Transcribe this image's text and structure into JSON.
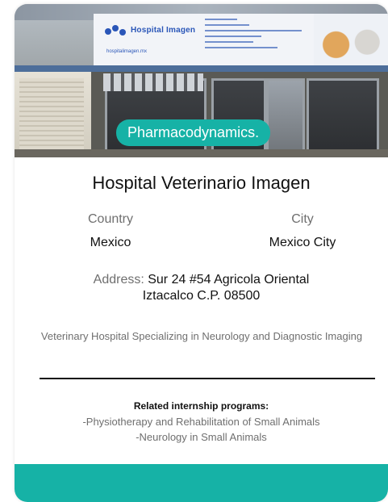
{
  "card": {
    "category_tag": "Pharmacodynamics.",
    "title": "Hospital Veterinario Imagen",
    "country_label": "Country",
    "country_value": "Mexico",
    "city_label": "City",
    "city_value": "Mexico City",
    "address_label": "Address:",
    "address_line1": "Sur 24 #54 Agricola Oriental",
    "address_line2": "Iztacalco C.P. 08500",
    "description": "Veterinary Hospital Specializing in Neurology and Diagnostic Imaging",
    "related_title": "Related internship programs:",
    "programs": [
      "-Physiotherapy and Rehabilitation of Small Animals",
      "-Neurology in Small Animals"
    ]
  },
  "photo": {
    "sign_text": "Hospital Imagen",
    "sign_url": "hospitalimagen.mx"
  },
  "colors": {
    "accent": "#16b2a6",
    "text": "#111111",
    "muted": "#6f6f6f"
  }
}
